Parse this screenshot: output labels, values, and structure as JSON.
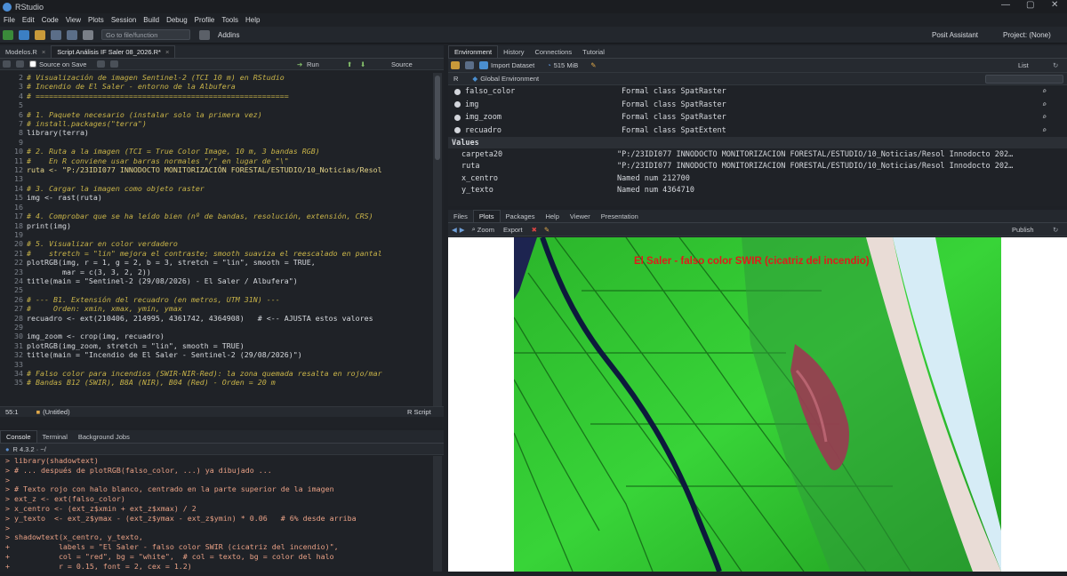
{
  "window": {
    "title": "RStudio"
  },
  "menu": [
    "File",
    "Edit",
    "Code",
    "View",
    "Plots",
    "Session",
    "Build",
    "Debug",
    "Profile",
    "Tools",
    "Help"
  ],
  "toolbar": {
    "goto_placeholder": "Go to file/function",
    "addins": "Addins",
    "posit_assistant": "Posit Assistant",
    "project": "Project: (None)"
  },
  "source": {
    "tabs": [
      "Modelos.R",
      "Script Análisis IF Saler 08_2026.R*"
    ],
    "source_on_save": "Source on Save",
    "run": "Run",
    "source_btn": "Source",
    "status_pos": "55:1",
    "status_scope": "(Untitled)",
    "status_type": "R Script",
    "lines": [
      {
        "n": "2",
        "t": "# Visualización de imagen Sentinel-2 (TCI 10 m) en RStudio",
        "c": "cmt"
      },
      {
        "n": "3",
        "t": "# Incendio de El Saler - entorno de la Albufera",
        "c": "cmt"
      },
      {
        "n": "4",
        "t": "# =========================================================",
        "c": "cmt"
      },
      {
        "n": "5",
        "t": "",
        "c": ""
      },
      {
        "n": "6",
        "t": "# 1. Paquete necesario (instalar solo la primera vez)",
        "c": "cmt"
      },
      {
        "n": "7",
        "t": "# install.packages(\"terra\")",
        "c": "cmt"
      },
      {
        "n": "8",
        "t": "library(terra)",
        "c": ""
      },
      {
        "n": "9",
        "t": "",
        "c": ""
      },
      {
        "n": "10",
        "t": "# 2. Ruta a la imagen (TCI = True Color Image, 10 m, 3 bandas RGB)",
        "c": "cmt"
      },
      {
        "n": "11",
        "t": "#    En R conviene usar barras normales \"/\" en lugar de \"\\\"",
        "c": "cmt"
      },
      {
        "n": "12",
        "t": "ruta <- \"P:/23IDI077 INNODOCTO MONITORIZACIÓN FORESTAL/ESTUDIO/10_Noticias/Resol",
        "c": "str"
      },
      {
        "n": "13",
        "t": "",
        "c": ""
      },
      {
        "n": "14",
        "t": "# 3. Cargar la imagen como objeto raster",
        "c": "cmt"
      },
      {
        "n": "15",
        "t": "img <- rast(ruta)",
        "c": ""
      },
      {
        "n": "16",
        "t": "",
        "c": ""
      },
      {
        "n": "17",
        "t": "# 4. Comprobar que se ha leído bien (nº de bandas, resolución, extensión, CRS)",
        "c": "cmt"
      },
      {
        "n": "18",
        "t": "print(img)",
        "c": ""
      },
      {
        "n": "19",
        "t": "",
        "c": ""
      },
      {
        "n": "20",
        "t": "# 5. Visualizar en color verdadero",
        "c": "cmt"
      },
      {
        "n": "21",
        "t": "#    stretch = \"lin\" mejora el contraste; smooth suaviza el reescalado en pantal",
        "c": "cmt"
      },
      {
        "n": "22",
        "t": "plotRGB(img, r = 1, g = 2, b = 3, stretch = \"lin\", smooth = TRUE,",
        "c": ""
      },
      {
        "n": "23",
        "t": "        mar = c(3, 3, 2, 2))",
        "c": ""
      },
      {
        "n": "24",
        "t": "title(main = \"Sentinel-2 (29/08/2026) - El Saler / Albufera\")",
        "c": ""
      },
      {
        "n": "25",
        "t": "",
        "c": ""
      },
      {
        "n": "26",
        "t": "# --- B1. Extensión del recuadro (en metros, UTM 31N) ---",
        "c": "cmt"
      },
      {
        "n": "27",
        "t": "#     Orden: xmin, xmax, ymin, ymax",
        "c": "cmt"
      },
      {
        "n": "28",
        "t": "recuadro <- ext(210406, 214995, 4361742, 4364908)   # <-- AJUSTA estos valores",
        "c": ""
      },
      {
        "n": "29",
        "t": "",
        "c": ""
      },
      {
        "n": "30",
        "t": "img_zoom <- crop(img, recuadro)",
        "c": ""
      },
      {
        "n": "31",
        "t": "plotRGB(img_zoom, stretch = \"lin\", smooth = TRUE)",
        "c": ""
      },
      {
        "n": "32",
        "t": "title(main = \"Incendio de El Saler - Sentinel-2 (29/08/2026)\")",
        "c": ""
      },
      {
        "n": "33",
        "t": "",
        "c": ""
      },
      {
        "n": "34",
        "t": "# Falso color para incendios (SWIR-NIR-Red): la zona quemada resalta en rojo/mar",
        "c": "cmt"
      },
      {
        "n": "35",
        "t": "# Bandas B12 (SWIR), B8A (NIR), B04 (Red) - Orden = 20 m",
        "c": "cmt"
      }
    ]
  },
  "console": {
    "tabs": [
      "Console",
      "Terminal",
      "Background Jobs"
    ],
    "version": "R 4.3.2 · ~/",
    "lines": [
      {
        "t": "> library(shadowtext)",
        "c": "cmd"
      },
      {
        "t": "> # ... después de plotRGB(falso_color, ...) ya dibujado ...",
        "c": "cmd"
      },
      {
        "t": ">",
        "c": "cmd"
      },
      {
        "t": "> # Texto rojo con halo blanco, centrado en la parte superior de la imagen",
        "c": "cmd"
      },
      {
        "t": "> ext_z <- ext(falso_color)",
        "c": "cmd"
      },
      {
        "t": "> x_centro <- (ext_z$xmin + ext_z$xmax) / 2",
        "c": "cmd"
      },
      {
        "t": "> y_texto  <- ext_z$ymax - (ext_z$ymax - ext_z$ymin) * 0.06   # 6% desde arriba",
        "c": "cmd"
      },
      {
        "t": ">",
        "c": "cmd"
      },
      {
        "t": "> shadowtext(x_centro, y_texto,",
        "c": "cmd"
      },
      {
        "t": "+           labels = \"El Saler - falso color SWIR (cicatriz del incendio)\",",
        "c": "cmd"
      },
      {
        "t": "+           col = \"red\", bg = \"white\",  # col = texto, bg = color del halo",
        "c": "cmd"
      },
      {
        "t": "+           r = 0.15, font = 2, cex = 1.2)",
        "c": "cmd"
      }
    ]
  },
  "environment": {
    "tabs": [
      "Environment",
      "History",
      "Connections",
      "Tutorial"
    ],
    "import_dataset": "Import Dataset",
    "memory": "515 MiB",
    "list_view": "List",
    "lang": "R",
    "scope": "Global Environment",
    "objects": [
      {
        "name": "falso_color",
        "desc": "Formal class  SpatRaster"
      },
      {
        "name": "img",
        "desc": "Formal class  SpatRaster"
      },
      {
        "name": "img_zoom",
        "desc": "Formal class  SpatRaster"
      },
      {
        "name": "recuadro",
        "desc": "Formal class  SpatExtent"
      }
    ],
    "values_header": "Values",
    "values": [
      {
        "name": "carpeta20",
        "desc": "\"P:/23IDI077 INNODOCTO MONITORIZACIÓN FORESTAL/ESTUDIO/10_Noticias/Resol Innodocto 202…"
      },
      {
        "name": "ruta",
        "desc": "\"P:/23IDI077 INNODOCTO MONITORIZACIÓN FORESTAL/ESTUDIO/10_Noticias/Resol Innodocto 202…"
      },
      {
        "name": "x_centro",
        "desc": "Named num 212700"
      },
      {
        "name": "y_texto",
        "desc": "Named num 4364710"
      }
    ]
  },
  "files": {
    "tabs": [
      "Files",
      "Plots",
      "Packages",
      "Help",
      "Viewer",
      "Presentation"
    ],
    "zoom": "Zoom",
    "export": "Export",
    "publish": "Publish",
    "plot_title": "El Saler - falso color SWIR (cicatriz del incendio)"
  },
  "colors": {
    "accent": "#4c8ed6",
    "plot_title": "#e01b1b",
    "veg": "#2fcf2f",
    "burn": "#9b3a52"
  }
}
